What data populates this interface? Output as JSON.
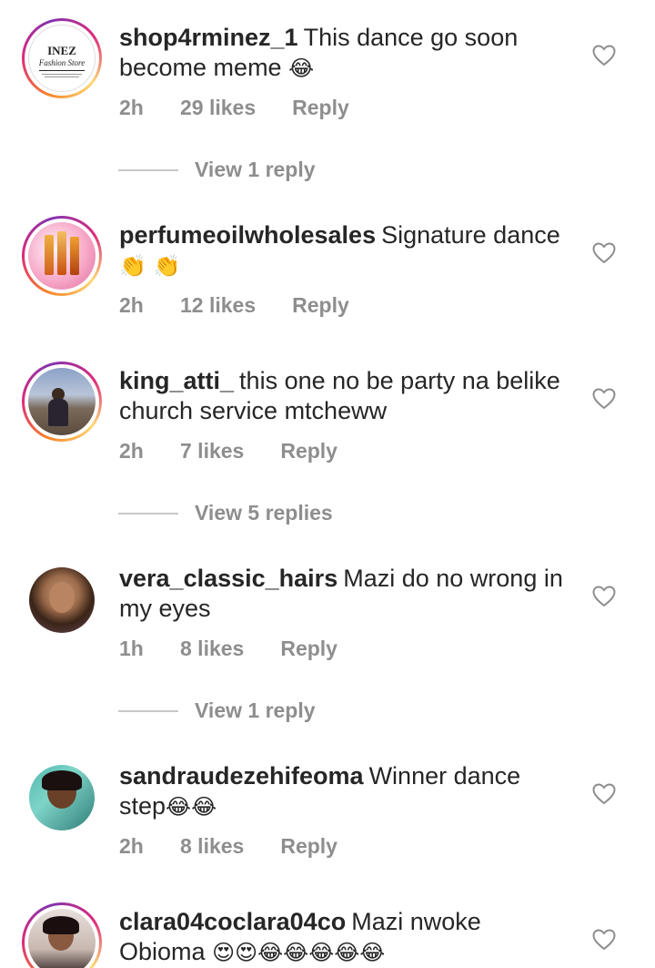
{
  "comments": [
    {
      "username": "shop4rminez_1",
      "text": "This dance go soon become meme",
      "emoji": "😂",
      "time": "2h",
      "likes": "29 likes",
      "reply": "Reply",
      "view_replies": "View 1 reply",
      "avatar_text_top": "INEZ",
      "avatar_text_sub": "Fashion Store"
    },
    {
      "username": "perfumeoilwholesales",
      "text": "Signature dance",
      "emoji": "👏 👏",
      "time": "2h",
      "likes": "12 likes",
      "reply": "Reply"
    },
    {
      "username": "king_atti_",
      "text": "this one no be party na belike church service mtcheww",
      "emoji": "",
      "time": "2h",
      "likes": "7 likes",
      "reply": "Reply",
      "view_replies": "View 5 replies"
    },
    {
      "username": "vera_classic_hairs",
      "text": "Mazi do no wrong in my eyes",
      "emoji": "",
      "time": "1h",
      "likes": "8 likes",
      "reply": "Reply",
      "view_replies": "View 1 reply"
    },
    {
      "username": "sandraudezehifeoma",
      "text": "Winner dance step",
      "emoji": "😂😂",
      "time": "2h",
      "likes": "8 likes",
      "reply": "Reply"
    },
    {
      "username": "clara04coclara04co",
      "text": "Mazi nwoke Obioma",
      "emoji": "😍😍😂😂😂😂😂"
    }
  ],
  "colors": {
    "text": "#262626",
    "meta": "#8e8e8e",
    "divider": "#c7c7c7"
  }
}
